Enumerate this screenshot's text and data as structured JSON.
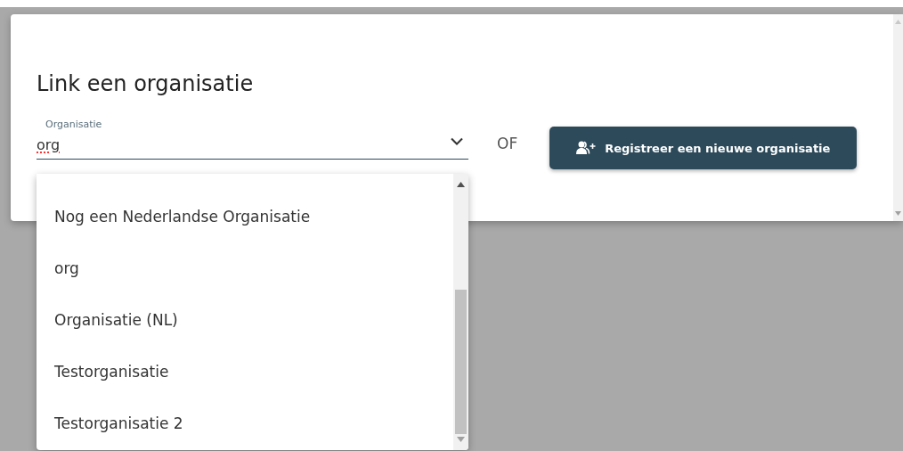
{
  "dialog": {
    "title": "Link een organisatie",
    "field": {
      "label": "Organisatie",
      "value": "org",
      "expanded": true
    },
    "separator": "OF",
    "button": {
      "label": "Registreer een nieuwe organisatie"
    }
  },
  "dropdown": {
    "options": [
      {
        "label": "Nog een Nederlandse Organisatie",
        "selected": false
      },
      {
        "label": "org",
        "selected": false
      },
      {
        "label": "Organisatie (NL)",
        "selected": false
      },
      {
        "label": "Testorganisatie",
        "selected": false
      },
      {
        "label": "Testorganisatie 2",
        "selected": false
      }
    ]
  }
}
